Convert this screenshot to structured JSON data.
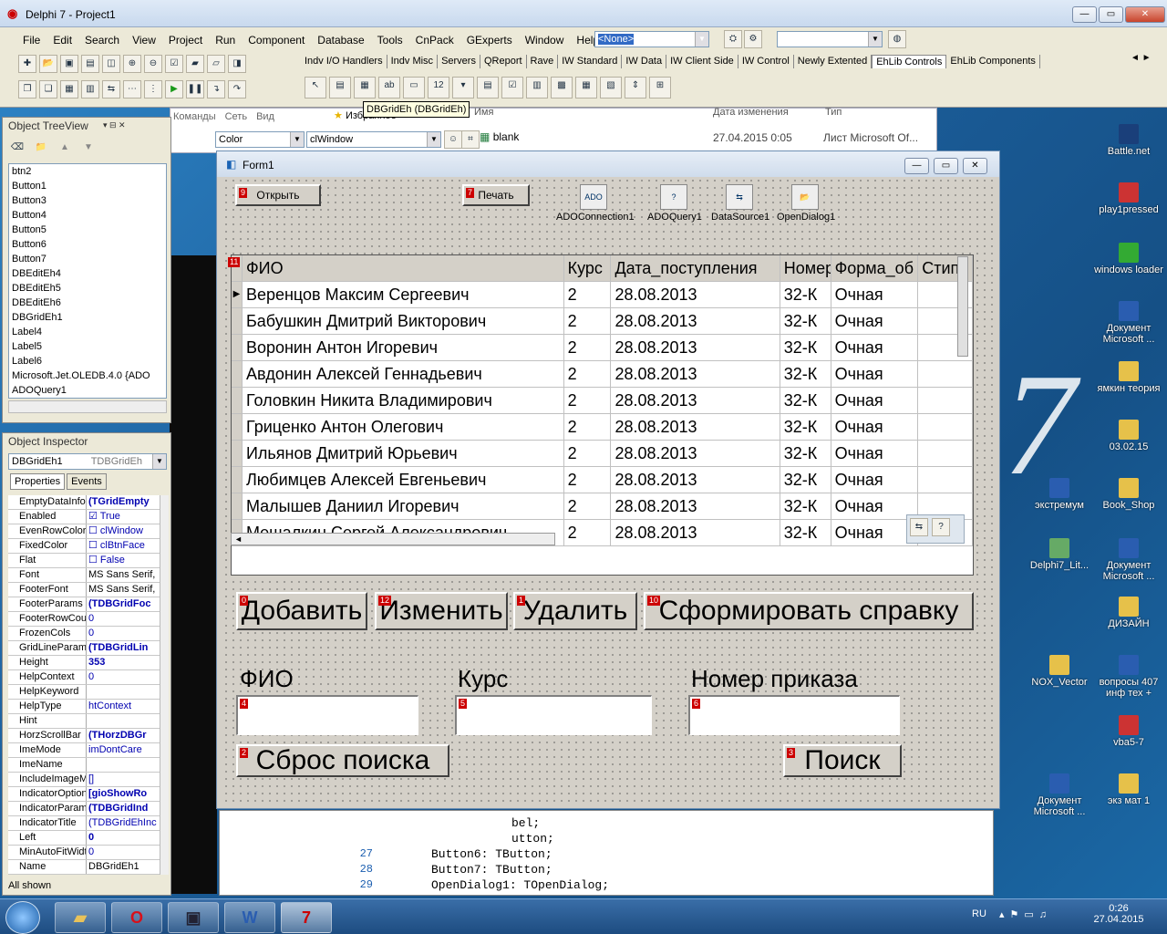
{
  "ide": {
    "title": "Delphi 7 - Project1",
    "menu": [
      "File",
      "Edit",
      "Search",
      "View",
      "Project",
      "Run",
      "Component",
      "Database",
      "Tools",
      "CnPack",
      "GExperts",
      "Window",
      "Help"
    ],
    "desktop_combo": "<None>",
    "palette_tabs": [
      "Indv I/O Handlers",
      "Indv Misc",
      "Servers",
      "QReport",
      "Rave",
      "IW Standard",
      "IW Data",
      "IW Client Side",
      "IW Control",
      "Newly Extented",
      "EhLib Controls",
      "EhLib Components"
    ],
    "tooltip": "DBGridEh (DBGridEh)"
  },
  "explorer": {
    "tabs": [
      "Команды",
      "Сеть",
      "Вид"
    ],
    "fav": "Избранное",
    "headers": [
      "Имя",
      "Дата изменения",
      "Тип"
    ],
    "row": {
      "name": "blank",
      "date": "27.04.2015 0:05",
      "type": "Лист Microsoft Of..."
    }
  },
  "treeview": {
    "title": "Object TreeView",
    "items": [
      "btn2",
      "Button1",
      "Button3",
      "Button4",
      "Button5",
      "Button6",
      "Button7",
      "DBEditEh4",
      "DBEditEh5",
      "DBEditEh6",
      "DBGridEh1",
      "Label4",
      "Label5",
      "Label6",
      "Microsoft.Jet.OLEDB.4.0 {ADO",
      "ADOQuery1"
    ]
  },
  "inspector": {
    "title": "Object Inspector",
    "object": "DBGridEh1",
    "type": "TDBGridEh",
    "tabs": [
      "Properties",
      "Events"
    ],
    "color_combo": "Color",
    "color_value": "clWindow",
    "rows": [
      {
        "k": "EmptyDataInfo",
        "v": "(TGridEmpty",
        "s": "b"
      },
      {
        "k": "Enabled",
        "v": "True",
        "s": "chk"
      },
      {
        "k": "EvenRowColor",
        "v": "clWindow",
        "s": "sw"
      },
      {
        "k": "FixedColor",
        "v": "clBtnFace",
        "s": "sw"
      },
      {
        "k": "Flat",
        "v": "False",
        "s": "chk0"
      },
      {
        "k": "Font",
        "v": "MS Sans Serif,",
        "s": "k2"
      },
      {
        "k": "FooterFont",
        "v": "MS Sans Serif,",
        "s": "k2"
      },
      {
        "k": "FooterParams",
        "v": "(TDBGridFoc",
        "s": "b"
      },
      {
        "k": "FooterRowCou",
        "v": "0",
        "s": ""
      },
      {
        "k": "FrozenCols",
        "v": "0",
        "s": ""
      },
      {
        "k": "GridLineParams",
        "v": "(TDBGridLin",
        "s": "b"
      },
      {
        "k": "Height",
        "v": "353",
        "s": "b"
      },
      {
        "k": "HelpContext",
        "v": "0",
        "s": ""
      },
      {
        "k": "HelpKeyword",
        "v": "",
        "s": ""
      },
      {
        "k": "HelpType",
        "v": "htContext",
        "s": ""
      },
      {
        "k": "Hint",
        "v": "",
        "s": ""
      },
      {
        "k": "HorzScrollBar",
        "v": "(THorzDBGr",
        "s": "b"
      },
      {
        "k": "ImeMode",
        "v": "imDontCare",
        "s": ""
      },
      {
        "k": "ImeName",
        "v": "",
        "s": ""
      },
      {
        "k": "IncludeImageM",
        "v": "[]",
        "s": ""
      },
      {
        "k": "IndicatorOption",
        "v": "[gioShowRo",
        "s": "b"
      },
      {
        "k": "IndicatorParam",
        "v": "(TDBGridInd",
        "s": "b"
      },
      {
        "k": "IndicatorTitle",
        "v": "(TDBGridEhInc",
        "s": ""
      },
      {
        "k": "Left",
        "v": "0",
        "s": "b"
      },
      {
        "k": "MinAutoFitWidt",
        "v": "0",
        "s": ""
      },
      {
        "k": "Name",
        "v": "DBGridEh1",
        "s": "k2"
      }
    ],
    "status": "All shown"
  },
  "form": {
    "title": "Form1",
    "btn_open": "Открыть",
    "btn_print": "Печать",
    "components": [
      "ADOConnection1",
      "ADOQuery1",
      "DataSource1",
      "OpenDialog1"
    ],
    "grid": {
      "columns": [
        "ФИО",
        "Курс",
        "Дата_поступления",
        "Номер",
        "Форма_об",
        "Стип"
      ],
      "rows": [
        [
          "Веренцов Максим Сергеевич",
          "2",
          "28.08.2013",
          "32-К",
          "Очная"
        ],
        [
          "Бабушкин Дмитрий Викторович",
          "2",
          "28.08.2013",
          "32-К",
          "Очная"
        ],
        [
          "Воронин Антон Игоревич",
          "2",
          "28.08.2013",
          "32-К",
          "Очная"
        ],
        [
          "Авдонин Алексей Геннадьевич",
          "2",
          "28.08.2013",
          "32-К",
          "Очная"
        ],
        [
          "Головкин Никита Владимирович",
          "2",
          "28.08.2013",
          "32-К",
          "Очная"
        ],
        [
          "Гриценко Антон Олегович",
          "2",
          "28.08.2013",
          "32-К",
          "Очная"
        ],
        [
          "Ильянов Дмитрий Юрьевич",
          "2",
          "28.08.2013",
          "32-К",
          "Очная"
        ],
        [
          "Любимцев Алексей Евгеньевич",
          "2",
          "28.08.2013",
          "32-К",
          "Очная"
        ],
        [
          "Малышев Даниил Игоревич",
          "2",
          "28.08.2013",
          "32-К",
          "Очная"
        ],
        [
          "Мешалкин Сергей Александрович",
          "2",
          "28.08.2013",
          "32-К",
          "Очная"
        ]
      ]
    },
    "btn_add": "Добавить",
    "btn_edit": "Изменить",
    "btn_delete": "Удалить",
    "btn_report": "Сформировать справку",
    "lbl_fio": "ФИО",
    "lbl_kurs": "Курс",
    "lbl_order": "Номер приказа",
    "btn_reset": "Сброс поиска",
    "btn_search": "Поиск"
  },
  "code": {
    "lines": [
      {
        "n": "",
        "t": "bel;"
      },
      {
        "n": "",
        "t": "utton;"
      },
      {
        "n": "27",
        "t": "Button6: TButton;"
      },
      {
        "n": "28",
        "t": "Button7: TButton;"
      },
      {
        "n": "29",
        "t": "OpenDialog1: TOpenDialog;"
      }
    ]
  },
  "desktop_icons": [
    {
      "label": "Battle.net",
      "color": "#1a3f7a"
    },
    {
      "label": "play1pressed",
      "color": "#c33"
    },
    {
      "label": "windows loader",
      "color": "#3a3"
    },
    {
      "label": "Документ Microsoft ...",
      "color": "#2a5db0"
    },
    {
      "label": "ямкин теория",
      "color": "#e6c14a"
    },
    {
      "label": "03.02.15",
      "color": "#e6c14a"
    },
    {
      "label": "экстремум",
      "color": "#2a5db0"
    },
    {
      "label": "Book_Shop",
      "color": "#e6c14a"
    },
    {
      "label": "Delphi7_Lit...",
      "color": "#6a6"
    },
    {
      "label": "Документ Microsoft ...",
      "color": "#2a5db0"
    },
    {
      "label": "ДИЗАЙН",
      "color": "#e6c14a"
    },
    {
      "label": "NOX_Vector",
      "color": "#e6c14a"
    },
    {
      "label": "вопросы 407 инф тех +",
      "color": "#2a5db0"
    },
    {
      "label": "vba5-7",
      "color": "#c33"
    },
    {
      "label": "Документ Microsoft ...",
      "color": "#2a5db0"
    },
    {
      "label": "экз мат 1",
      "color": "#e6c14a"
    }
  ],
  "taskbar": {
    "lang": "RU",
    "time": "0:26",
    "date": "27.04.2015"
  }
}
